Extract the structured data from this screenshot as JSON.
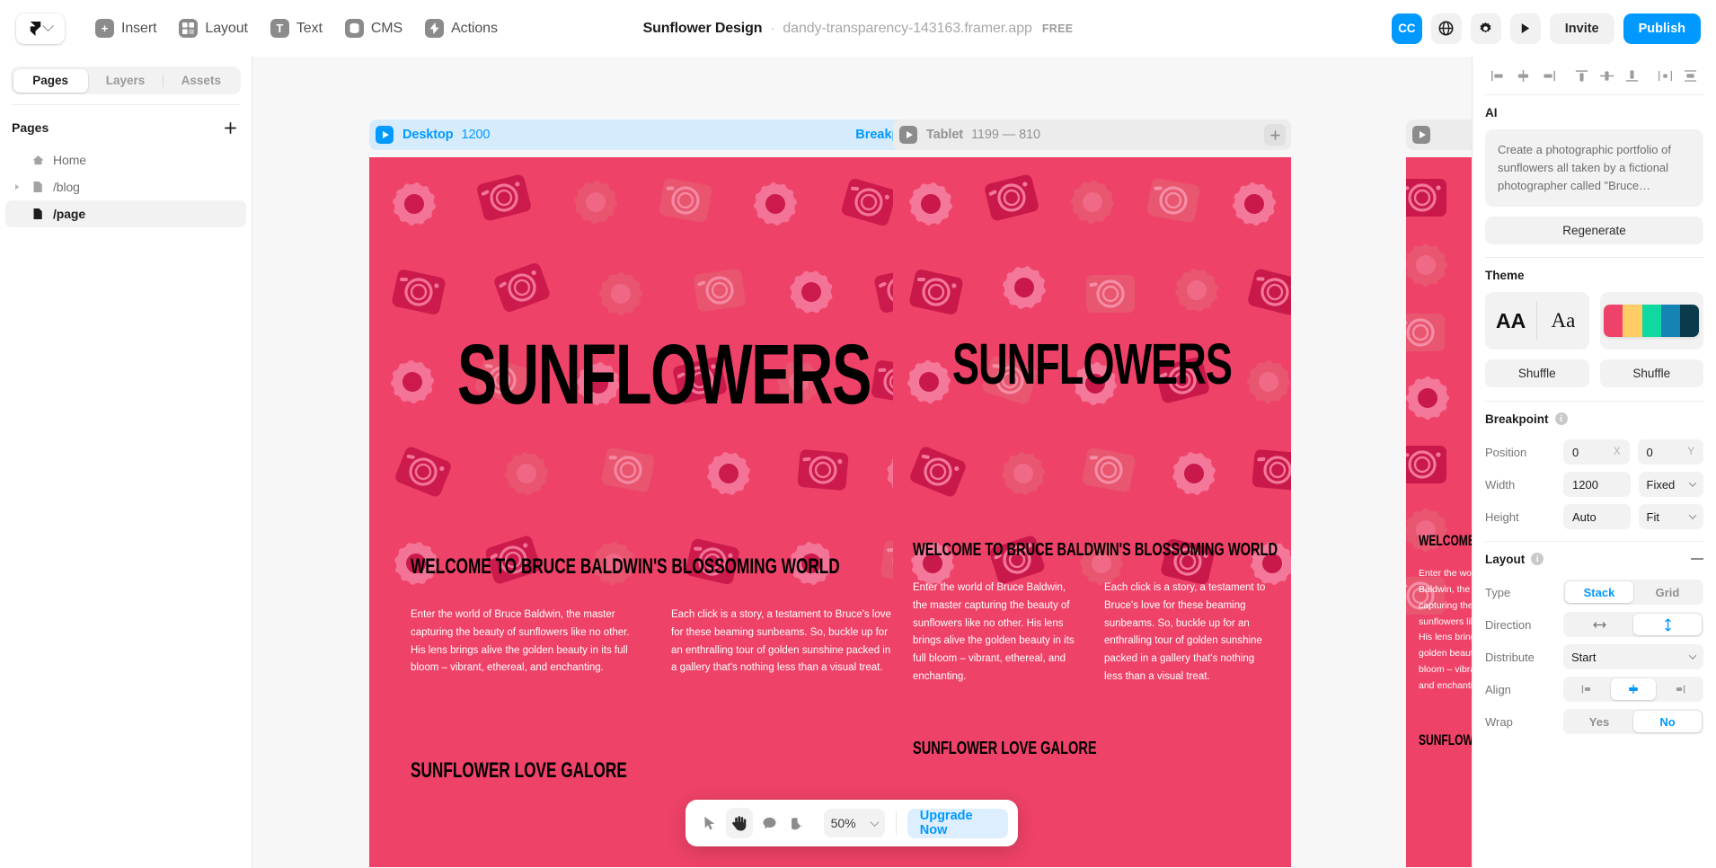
{
  "topbar": {
    "logo_icon": "framer-logo-icon",
    "logo_chevron": "chevron-down-icon",
    "menu": [
      {
        "label": "Insert",
        "icon": "plus-icon"
      },
      {
        "label": "Layout",
        "icon": "layout-grid-icon"
      },
      {
        "label": "Text",
        "icon": "text-t-icon"
      },
      {
        "label": "CMS",
        "icon": "database-icon"
      },
      {
        "label": "Actions",
        "icon": "lightning-bolt-icon"
      }
    ],
    "project_name": "Sunflower Design",
    "separator": "·",
    "domain": "dandy-transparency-143163.framer.app",
    "plan_badge": "FREE",
    "avatar_initials": "CC",
    "globe_icon": "globe-icon",
    "settings_icon": "gear-icon",
    "preview_icon": "play-icon",
    "invite_label": "Invite",
    "publish_label": "Publish",
    "accent_blue": "#0099ff"
  },
  "left_panel": {
    "tabs": [
      {
        "label": "Pages",
        "active": true
      },
      {
        "label": "Layers",
        "active": false
      },
      {
        "label": "Assets",
        "active": false
      }
    ],
    "section_title": "Pages",
    "add_page_icon": "plus-icon",
    "pages": [
      {
        "label": "Home",
        "icon": "home-icon",
        "selected": false,
        "has_disclosure": false
      },
      {
        "label": "/blog",
        "icon": "page-icon",
        "selected": false,
        "has_disclosure": true
      },
      {
        "label": "/page",
        "icon": "page-icon",
        "selected": true,
        "has_disclosure": false
      }
    ]
  },
  "canvas": {
    "background": "#f7f7f7",
    "frames": [
      {
        "name": "Desktop",
        "size": "1200",
        "breakpoint_label": "Breakpoint",
        "add_icon": "plus-icon",
        "active": true,
        "play_icon": "play-icon"
      },
      {
        "name": "Tablet",
        "size": "1199 — 810",
        "breakpoint_label": "",
        "add_icon": "plus-icon",
        "active": false,
        "play_icon": "play-icon"
      }
    ],
    "site": {
      "bg_color": "#ef4268",
      "hero_title": "SUNFLOWERS",
      "section_heading": "WELCOME TO BRUCE BALDWIN'S BLOSSOMING WORLD",
      "body_col_1": "Enter the world of Bruce Baldwin, the master capturing the beauty of sunflowers like no other. His lens brings alive the golden beauty in its full bloom – vibrant, ethereal, and enchanting.",
      "body_col_2": "Each click is a story, a testament to Bruce's love for these beaming sunbeams. So, buckle up for an enthralling tour of golden sunshine packed in a gallery that's nothing less than a visual treat.",
      "next_heading": "SUNFLOWER LOVE GALORE"
    }
  },
  "bottombar": {
    "tools": [
      {
        "icon": "cursor-arrow-icon",
        "active": false
      },
      {
        "icon": "hand-pan-icon",
        "active": true
      },
      {
        "icon": "comment-bubble-icon",
        "active": false
      },
      {
        "icon": "moon-dark-mode-icon",
        "active": false
      }
    ],
    "zoom_value": "50%",
    "zoom_chevron": "chevron-down-icon",
    "upgrade_label": "Upgrade Now"
  },
  "right_panel": {
    "align_icons": [
      "align-left-icon",
      "align-center-horizontal-icon",
      "align-right-icon",
      "align-top-icon",
      "align-middle-vertical-icon",
      "align-bottom-icon",
      "distribute-horizontal-icon",
      "distribute-vertical-icon"
    ],
    "ai": {
      "title": "AI",
      "prompt": "Create a photographic portfolio of sunflowers all taken by a fictional photographer called \"Bruce…",
      "regenerate_label": "Regenerate"
    },
    "theme": {
      "title": "Theme",
      "font_bold_sample": "AA",
      "font_serif_sample": "Aa",
      "palette": [
        "#ef4268",
        "#ffcc66",
        "#0fd9a0",
        "#1683b5",
        "#0b3a4d"
      ],
      "shuffle_font_label": "Shuffle",
      "shuffle_color_label": "Shuffle"
    },
    "breakpoint": {
      "title": "Breakpoint",
      "info_icon": "info-icon",
      "position_label": "Position",
      "position_x": "0",
      "position_x_suffix": "X",
      "position_y": "0",
      "position_y_suffix": "Y",
      "width_label": "Width",
      "width_value": "1200",
      "width_mode": "Fixed",
      "height_label": "Height",
      "height_value": "Auto",
      "height_mode": "Fit"
    },
    "layout": {
      "title": "Layout",
      "info_icon": "info-icon",
      "collapse_icon": "minus-icon",
      "type_label": "Type",
      "type_options": [
        "Stack",
        "Grid"
      ],
      "type_selected": "Stack",
      "direction_label": "Direction",
      "direction_options": [
        "horizontal-arrow-icon",
        "vertical-arrow-icon"
      ],
      "direction_selected": "vertical-arrow-icon",
      "distribute_label": "Distribute",
      "distribute_value": "Start",
      "align_label": "Align",
      "align_options": [
        "align-start-icon",
        "align-center-icon",
        "align-end-icon"
      ],
      "align_selected": "align-center-icon",
      "wrap_label": "Wrap",
      "wrap_options": [
        "Yes",
        "No"
      ],
      "wrap_selected": "No"
    }
  }
}
